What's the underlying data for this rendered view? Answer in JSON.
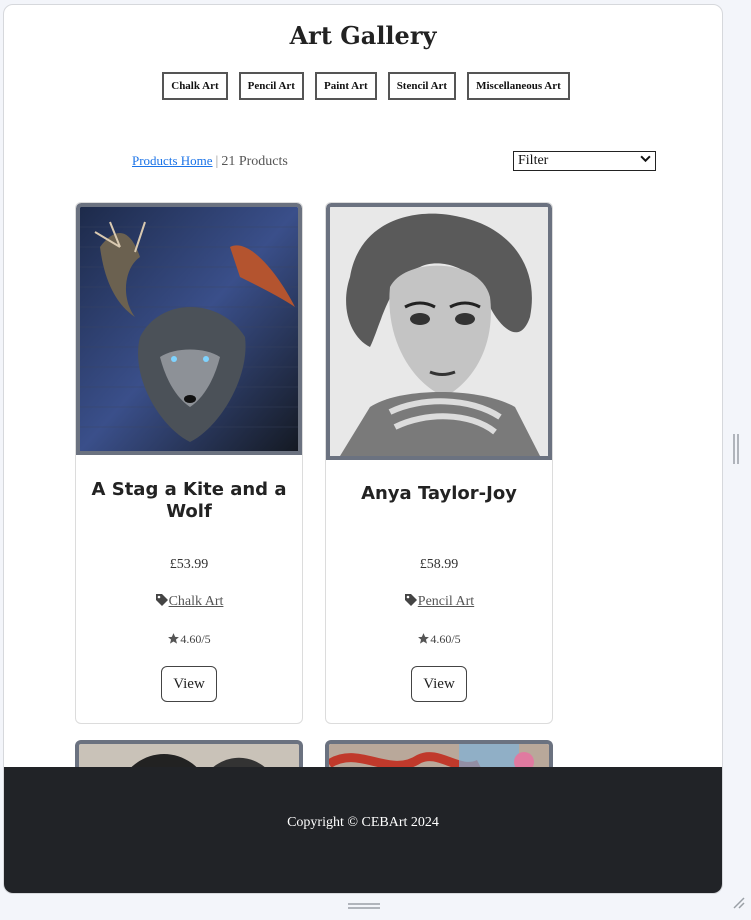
{
  "header": {
    "title": "Art Gallery"
  },
  "nav": [
    {
      "label": "Chalk Art"
    },
    {
      "label": "Pencil Art"
    },
    {
      "label": "Paint Art"
    },
    {
      "label": "Stencil Art"
    },
    {
      "label": "Miscellaneous Art"
    }
  ],
  "breadcrumb": {
    "home_label": "Products Home",
    "separator": "|",
    "count": "21 Products"
  },
  "filter": {
    "selected": "Filter"
  },
  "products": [
    {
      "title": "A Stag a Kite and a Wolf",
      "price": "£53.99",
      "category": "Chalk Art",
      "rating": "4.60/5",
      "view_label": "View",
      "icon": "tag-icon"
    },
    {
      "title": "Anya Taylor-Joy",
      "price": "£58.99",
      "category": "Pencil Art",
      "rating": "4.60/5",
      "view_label": "View",
      "icon": "tag-icon"
    }
  ],
  "footer": {
    "copyright": "Copyright © CEBArt 2024"
  },
  "colors": {
    "footer_bg": "#212327",
    "link": "#1a73e8",
    "image_border": "#6b7280"
  }
}
